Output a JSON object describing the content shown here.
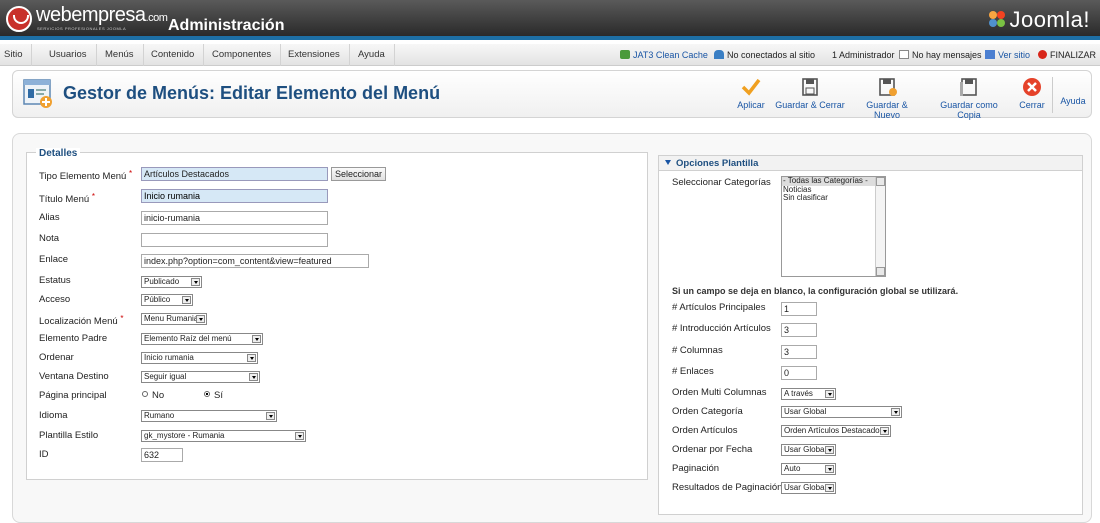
{
  "header": {
    "brand": "webempresa",
    "brand_suffix": ".com",
    "brand_tagline": "SERVICIOS PROFESIONALES JOOMLA",
    "title": "Administración",
    "cms_logo": "Joomla!"
  },
  "menubar": {
    "items": [
      "Sitio",
      "Usuarios",
      "Menús",
      "Contenido",
      "Componentes",
      "Extensiones",
      "Ayuda"
    ],
    "status": {
      "cache": "JAT3 Clean Cache",
      "connected": "No conectados al sitio",
      "admins": "1 Administrador",
      "messages": "No hay mensajes",
      "view_site": "Ver sitio",
      "logout": "FINALIZAR"
    }
  },
  "toolbar": {
    "title": "Gestor de Menús: Editar Elemento del Menú",
    "buttons": {
      "apply": "Aplicar",
      "save_close": "Guardar & Cerrar",
      "save_new": "Guardar & Nuevo",
      "save_copy": "Guardar como Copia",
      "close": "Cerrar",
      "help": "Ayuda"
    }
  },
  "details": {
    "legend": "Detalles",
    "labels": {
      "menu_item_type": "Tipo Elemento Menú",
      "menu_title": "Título Menú",
      "alias": "Alias",
      "note": "Nota",
      "link": "Enlace",
      "status": "Estatus",
      "access": "Acceso",
      "menu_location": "Localización Menú",
      "parent": "Elemento Padre",
      "ordering": "Ordenar",
      "target_window": "Ventana Destino",
      "home": "Página principal",
      "language": "Idioma",
      "template_style": "Plantilla Estilo",
      "id": "ID"
    },
    "values": {
      "menu_item_type": "Artículos Destacados",
      "select_button": "Seleccionar",
      "menu_title": "Inicio rumania",
      "alias": "inicio-rumania",
      "note": "",
      "link": "index.php?option=com_content&view=featured",
      "status": "Publicado",
      "access": "Público",
      "menu_location": "Menu Rumania",
      "parent": "Elemento Raíz del menú",
      "ordering": "Inicio rumania",
      "target_window": "Seguir igual",
      "home_no": "No",
      "home_yes": "Sí",
      "home_selected": "yes",
      "language": "Rumano",
      "template_style": "gk_mystore - Rumania",
      "id": "632"
    }
  },
  "options": {
    "title": "Opciones Plantilla",
    "labels": {
      "categories": "Seleccionar Categorías",
      "hint": "Si un campo se deja en blanco, la configuración global se utilizará.",
      "leading": "# Artículos Principales",
      "intro": "# Introducción Artículos",
      "columns": "# Columnas",
      "links": "# Enlaces",
      "multi_column_order": "Orden Multi Columnas",
      "category_order": "Orden Categoría",
      "article_order": "Orden Artículos",
      "date_order": "Ordenar por Fecha",
      "pagination": "Paginación",
      "pagination_results": "Resultados de Paginación"
    },
    "categories": [
      "- Todas las Categorías -",
      "Noticias",
      "Sin clasificar"
    ],
    "values": {
      "leading": "1",
      "intro": "3",
      "columns": "3",
      "links": "0",
      "multi_column_order": "A través",
      "category_order": "Usar Global",
      "article_order": "Orden Artículos Destacados",
      "date_order": "Usar Global",
      "pagination": "Auto",
      "pagination_results": "Usar Global"
    }
  },
  "colors": {
    "accent_blue": "#1955a4",
    "title_blue": "#1e4f80",
    "header_bar": "#1d6fa5"
  }
}
